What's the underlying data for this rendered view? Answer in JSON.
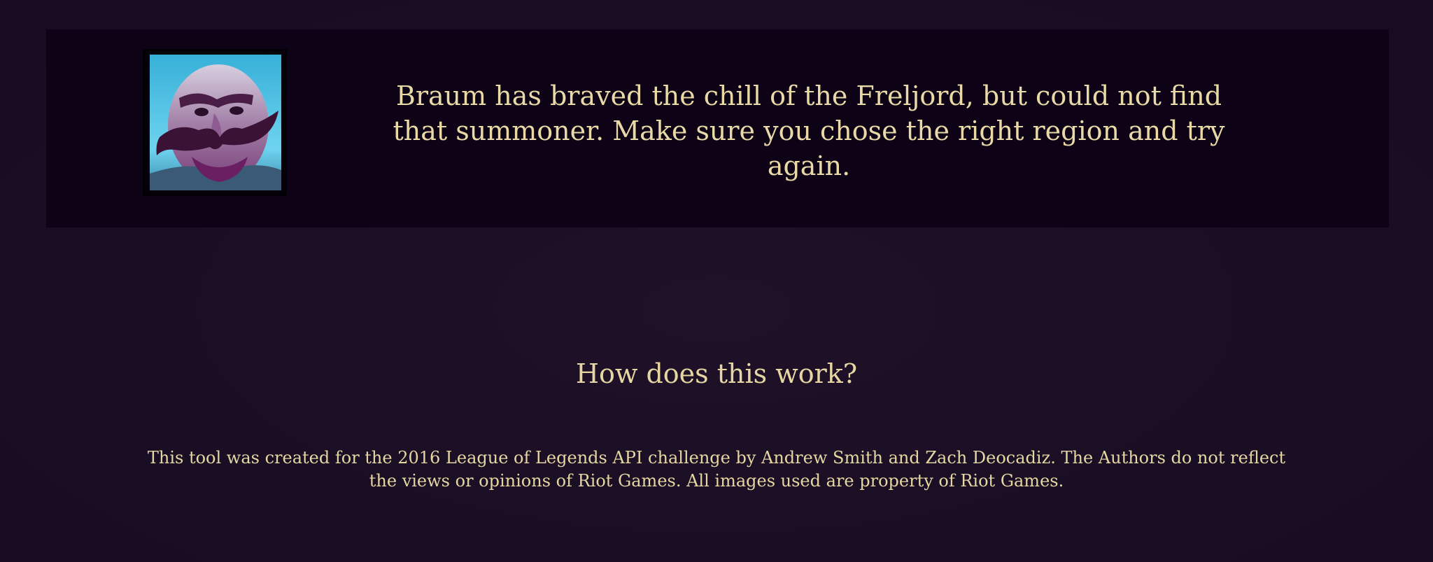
{
  "error_banner": {
    "champion_portrait": "braum-portrait",
    "message": "Braum has braved the chill of the Freljord, but could not find that summoner. Make sure you chose the right region and try again."
  },
  "faq": {
    "heading": "How does this work?",
    "disclaimer": "This tool was created for the 2016 League of Legends API challenge by Andrew Smith and Zach Deocadiz. The Authors do not reflect the views or opinions of Riot Games. All images used are property of Riot Games."
  },
  "colors": {
    "background": "#1b0f25",
    "banner": "#0d0216",
    "text": "#e6d6a2",
    "portrait_sky": "#5fcbea"
  }
}
